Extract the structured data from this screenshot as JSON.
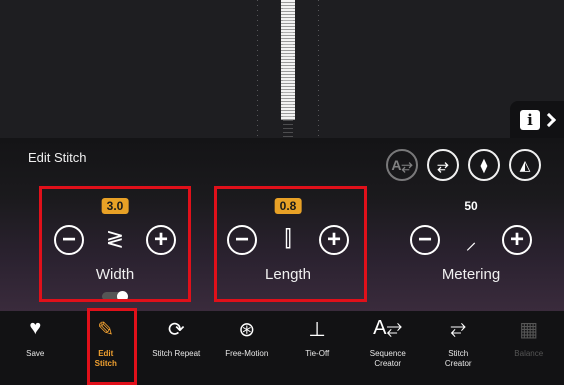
{
  "info_icon_text": "i",
  "panel": {
    "title": "Edit Stitch",
    "top_icons": [
      {
        "name": "mirror-text-icon",
        "glyph": "A⥂",
        "dim": true
      },
      {
        "name": "stitch-program-icon",
        "glyph": "⥂",
        "dim": false
      },
      {
        "name": "mirror-vertical-icon",
        "glyph": "⧫",
        "dim": false
      },
      {
        "name": "flip-horizontal-icon",
        "glyph": "◭",
        "dim": false
      }
    ]
  },
  "controls": {
    "width": {
      "label": "Width",
      "value": "3.0",
      "minus": "−",
      "plus": "+",
      "icon": "≷"
    },
    "length": {
      "label": "Length",
      "value": "0.8",
      "minus": "−",
      "plus": "+",
      "icon": "⫿"
    },
    "metering": {
      "label": "Metering",
      "value": "50",
      "minus": "−",
      "plus": "+",
      "icon": "⸝"
    }
  },
  "toolbar": [
    {
      "id": "save",
      "label": "Save",
      "icon": "♥"
    },
    {
      "id": "edit-stitch",
      "label": "Edit\nStitch",
      "icon": "✎",
      "active": true
    },
    {
      "id": "stitch-repeat",
      "label": "Stitch Repeat",
      "icon": "⟳"
    },
    {
      "id": "free-motion",
      "label": "Free-Motion",
      "icon": "⊛"
    },
    {
      "id": "tie-off",
      "label": "Tie-Off",
      "icon": "⊥"
    },
    {
      "id": "sequence-creator",
      "label": "Sequence\nCreator",
      "icon": "A⥂"
    },
    {
      "id": "stitch-creator",
      "label": "Stitch\nCreator",
      "icon": "⥂"
    },
    {
      "id": "balance",
      "label": "Balance",
      "icon": "▦",
      "disabled": true
    }
  ]
}
